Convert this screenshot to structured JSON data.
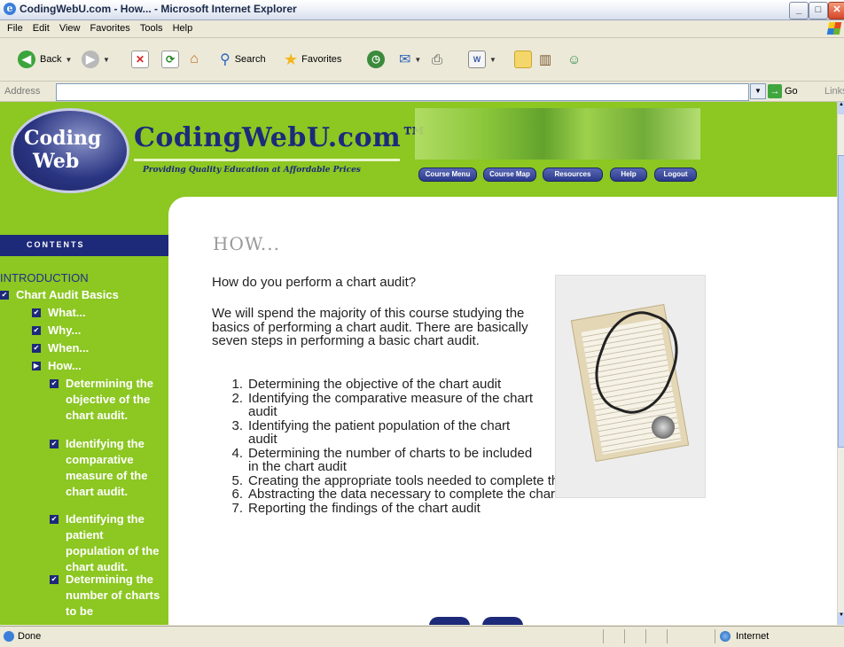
{
  "window": {
    "title": "CodingWebU.com - How... - Microsoft Internet Explorer"
  },
  "menu": [
    "File",
    "Edit",
    "View",
    "Favorites",
    "Tools",
    "Help"
  ],
  "toolbar": {
    "back_label": "Back",
    "search_label": "Search",
    "favorites_label": "Favorites"
  },
  "address": {
    "label": "Address",
    "value": "",
    "go_label": "Go",
    "links_label": "Links"
  },
  "site": {
    "logo_line1": "Coding",
    "logo_line2": "Web",
    "brand_name": "CodingWebU.com™",
    "tagline": "Providing Quality Education at Affordable Prices",
    "nav": [
      "Course Menu",
      "Course Map",
      "Resources",
      "Help",
      "Logout"
    ]
  },
  "sidebar": {
    "heading": "CONTENTS",
    "intro": "INTRODUCTION",
    "items": [
      {
        "label": "Chart Audit Basics",
        "level": 0
      },
      {
        "label": "What...",
        "level": 1
      },
      {
        "label": "Why...",
        "level": 1
      },
      {
        "label": "When...",
        "level": 1
      },
      {
        "label": "How...",
        "level": 1
      },
      {
        "label": "Determining the objective of the chart audit.",
        "level": 2
      },
      {
        "label": "Identifying the comparative measure of the chart audit.",
        "level": 2
      },
      {
        "label": "Identifying the patient population of the chart audit.",
        "level": 2
      },
      {
        "label": "Determining the number of charts to be",
        "level": 2
      }
    ]
  },
  "content": {
    "title": "HOW...",
    "question": "How do you perform a chart audit?",
    "paragraph": "We will spend the majority of this course studying the basics of performing a chart audit. There are basically seven steps in performing a basic chart audit.",
    "steps": [
      "Determining the objective of the chart audit",
      "Identifying the comparative measure of the chart audit",
      "Identifying the patient population of the chart audit",
      "Determining the number of charts to be included in the chart audit",
      "Creating the appropriate tools needed to complete the chart audit",
      "Abstracting the data necessary to complete the chart audit",
      "Reporting the findings of the chart audit"
    ]
  },
  "status": {
    "text": "Done",
    "zone": "Internet"
  }
}
